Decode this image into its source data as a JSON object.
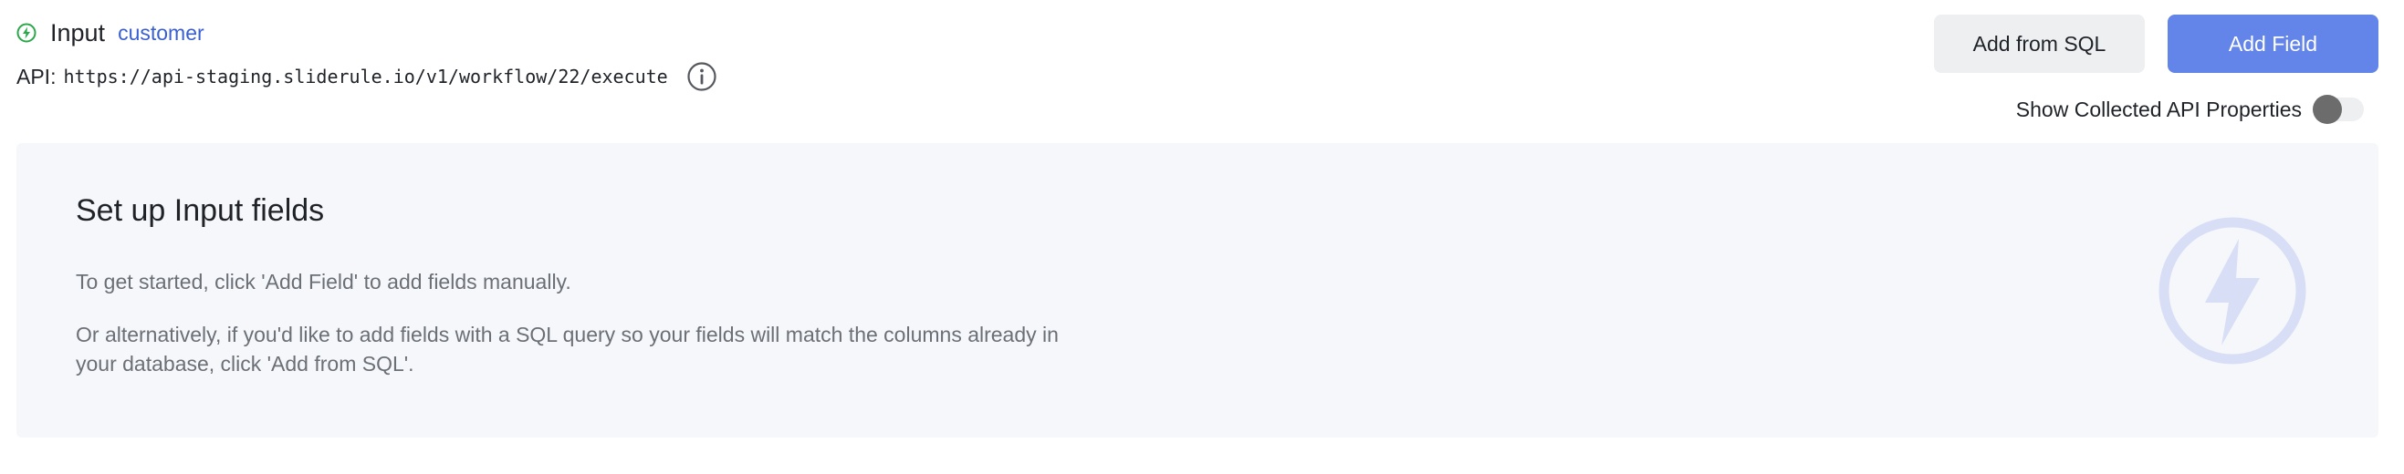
{
  "header": {
    "title": "Input",
    "title_link": "customer",
    "api_label": "API:",
    "api_url": "https://api-staging.sliderule.io/v1/workflow/22/execute",
    "status_icon": "lightning-circle-icon",
    "info_icon": "info-circle-icon"
  },
  "actions": {
    "add_from_sql": "Add from SQL",
    "add_field": "Add Field"
  },
  "toggle": {
    "label": "Show Collected API Properties",
    "checked": false
  },
  "empty_state": {
    "title": "Set up Input fields",
    "line1": "To get started, click 'Add Field' to add fields manually.",
    "line2": "Or alternatively, if you'd like to add fields with a SQL query so your fields will match the columns already in your database, click 'Add from SQL'.",
    "illustration_icon": "lightning-bolt-icon"
  },
  "colors": {
    "primary": "#6384e8",
    "link": "#3a5fd0",
    "status_green": "#2aa84a",
    "panel_bg": "#f6f7fb",
    "illustration": "#d8def5"
  }
}
